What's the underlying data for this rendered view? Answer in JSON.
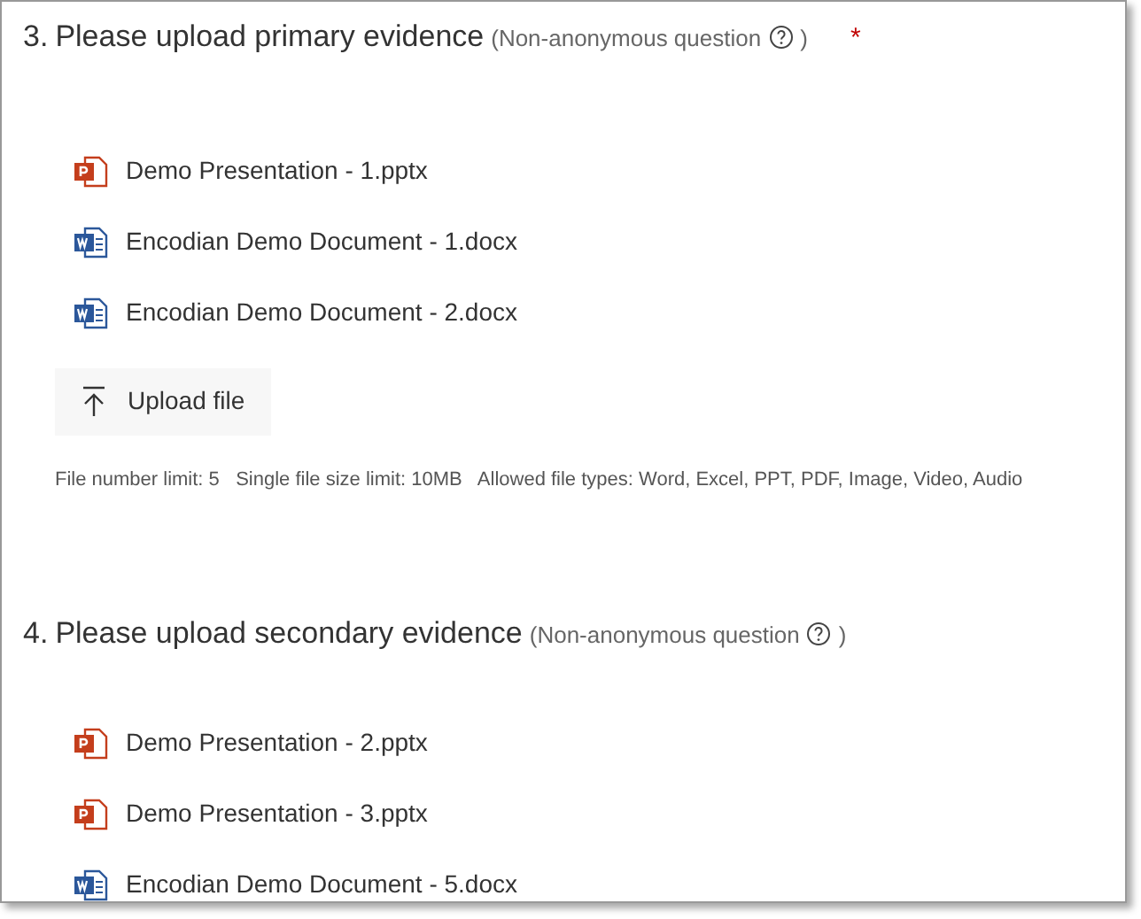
{
  "questions": [
    {
      "number": "3.",
      "title": "Please upload primary evidence",
      "note_open": "(Non-anonymous question",
      "note_close": ")",
      "required_mark": "*",
      "files": [
        {
          "kind": "pptx",
          "name": "Demo Presentation - 1.pptx"
        },
        {
          "kind": "docx",
          "name": "Encodian Demo Document - 1.docx"
        },
        {
          "kind": "docx",
          "name": "Encodian Demo Document - 2.docx"
        }
      ],
      "upload_button": "Upload file",
      "limits": "File number limit: 5   Single file size limit: 10MB   Allowed file types: Word, Excel, PPT, PDF, Image, Video, Audio"
    },
    {
      "number": "4.",
      "title": "Please upload secondary evidence",
      "note_open": "(Non-anonymous question",
      "note_close": ")",
      "files": [
        {
          "kind": "pptx",
          "name": "Demo Presentation - 2.pptx"
        },
        {
          "kind": "pptx",
          "name": "Demo Presentation - 3.pptx"
        },
        {
          "kind": "docx",
          "name": "Encodian Demo Document - 5.docx"
        }
      ]
    }
  ]
}
